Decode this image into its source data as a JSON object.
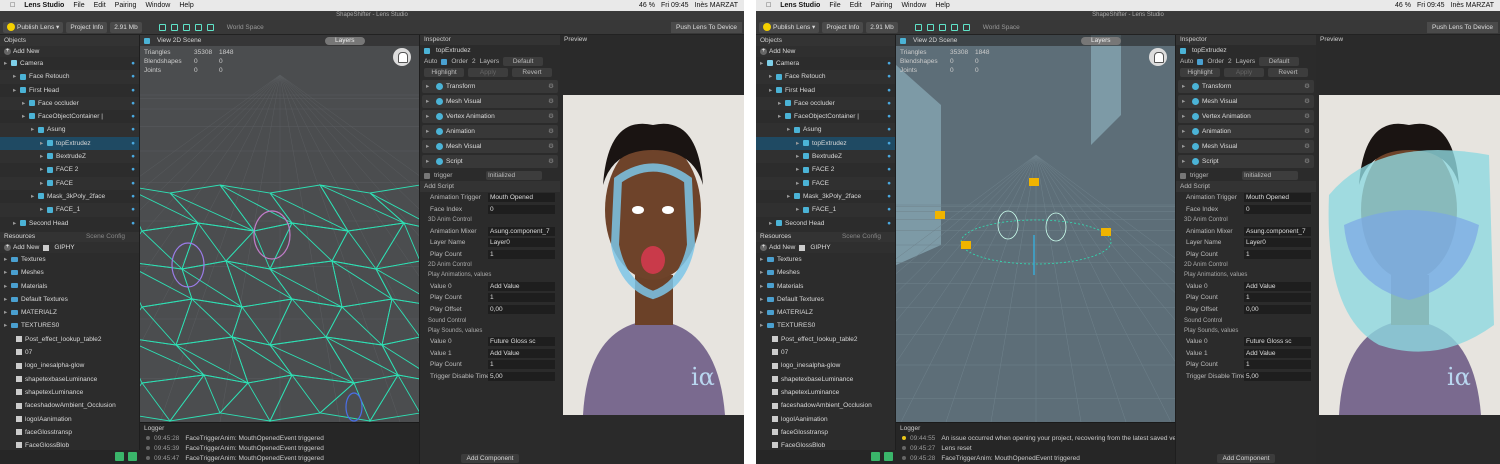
{
  "menubar": {
    "app": "Lens Studio",
    "items": [
      "File",
      "Edit",
      "Pairing",
      "Window",
      "Help"
    ],
    "battery": "46 %",
    "clock": "Fri 09:45",
    "user": "Inès MARZAT"
  },
  "window_title": "ShapeShifter - Lens Studio",
  "toolbar": {
    "publish": "Publish Lens",
    "project_info": "Project Info",
    "size": "2.91 Mb",
    "world_space": "World Space",
    "push": "Push Lens To Device"
  },
  "objects": {
    "title": "Objects",
    "add_new": "Add New",
    "rows": [
      {
        "label": "Camera",
        "indent": 0,
        "icon": "camera"
      },
      {
        "label": "Face Retouch",
        "indent": 1
      },
      {
        "label": "First Head",
        "indent": 1
      },
      {
        "label": "Face occluder",
        "indent": 2
      },
      {
        "label": "FaceObjectContainer |",
        "indent": 2
      },
      {
        "label": "Asung",
        "indent": 3
      },
      {
        "label": "topExtrudez",
        "indent": 4,
        "selected": true
      },
      {
        "label": "BextrudeZ",
        "indent": 4
      },
      {
        "label": "FACE 2",
        "indent": 4
      },
      {
        "label": "FACE",
        "indent": 4
      },
      {
        "label": "Mask_3kPoly_2face",
        "indent": 3
      },
      {
        "label": "FACE_1",
        "indent": 4
      },
      {
        "label": "Second Head",
        "indent": 1
      }
    ]
  },
  "resources": {
    "tab_resources": "Resources",
    "tab_scene": "Scene Config",
    "add_new": "Add New",
    "giphy": "GIPHY",
    "items": [
      {
        "label": "Textures",
        "type": "folder",
        "indent": 0
      },
      {
        "label": "Meshes",
        "type": "folder",
        "indent": 0
      },
      {
        "label": "Materials",
        "type": "folder",
        "indent": 0
      },
      {
        "label": "Default Textures",
        "type": "folder",
        "indent": 0
      },
      {
        "label": "MATERIALZ",
        "type": "folder",
        "indent": 0
      },
      {
        "label": "TEXTURES0",
        "type": "folder",
        "indent": 0
      },
      {
        "label": "Post_effect_lookup_table2",
        "type": "file",
        "indent": 1
      },
      {
        "label": "07",
        "type": "file",
        "indent": 1
      },
      {
        "label": "logo_inesalpha-glow",
        "type": "file",
        "indent": 1
      },
      {
        "label": "shapetexbaseLuminance",
        "type": "file",
        "indent": 1
      },
      {
        "label": "shapetexLuminance",
        "type": "file",
        "indent": 1
      },
      {
        "label": "faceshadowAmbient_Occlusion",
        "type": "file",
        "indent": 1
      },
      {
        "label": "logoIAanimation",
        "type": "file",
        "indent": 1
      },
      {
        "label": "faceGlosstransp",
        "type": "file",
        "indent": 1
      },
      {
        "label": "FaceGlossBlob",
        "type": "file",
        "indent": 1
      }
    ]
  },
  "viewport": {
    "view2d": "View 2D Scene",
    "layers": "Layers",
    "stats": [
      {
        "label": "Triangles",
        "a": "35308",
        "b": "1848"
      },
      {
        "label": "Blendshapes",
        "a": "0",
        "b": "0"
      },
      {
        "label": "Joints",
        "a": "0",
        "b": "0"
      }
    ]
  },
  "logger_a": {
    "title": "Logger",
    "lines": [
      {
        "time": "09:45:28",
        "msg": "FaceTriggerAnim: MouthOpenedEvent triggered",
        "warn": false
      },
      {
        "time": "09:45:39",
        "msg": "FaceTriggerAnim: MouthOpenedEvent triggered",
        "warn": false
      },
      {
        "time": "09:45:47",
        "msg": "FaceTriggerAnim: MouthOpenedEvent triggered",
        "warn": false
      }
    ]
  },
  "logger_b": {
    "title": "Logger",
    "lines": [
      {
        "time": "09:44:55",
        "msg": "An issue occurred when opening your project, recovering from the latest saved version",
        "warn": true
      },
      {
        "time": "09:45:27",
        "msg": "Lens reset",
        "warn": false
      },
      {
        "time": "09:45:28",
        "msg": "FaceTriggerAnim: MouthOpenedEvent triggered",
        "warn": false
      }
    ]
  },
  "inspector": {
    "title": "Inspector",
    "object": "topExtrudez",
    "auto": "Auto",
    "order": "Order",
    "order_val": "2",
    "layers": "Layers",
    "default": "Default",
    "highlight": "Highlight",
    "apply": "Apply",
    "revert": "Revert",
    "components": [
      "Transform",
      "Mesh Visual",
      "Vertex Animation",
      "Animation",
      "Mesh Visual",
      "Script"
    ],
    "script_name": "trigger",
    "script_state": "Initialized",
    "add_script": "Add Script",
    "props": [
      {
        "type": "prop",
        "label": "Animation Trigger",
        "value": "Mouth Opened"
      },
      {
        "type": "prop",
        "label": "Face Index",
        "value": "0"
      },
      {
        "type": "sect",
        "label": "3D Anim Control"
      },
      {
        "type": "prop",
        "label": "Animation Mixer",
        "value": "Asung.component_7"
      },
      {
        "type": "prop",
        "label": "Layer Name",
        "value": "Layer0"
      },
      {
        "type": "prop",
        "label": "Play Count",
        "value": "1"
      },
      {
        "type": "sect",
        "label": "2D Anim Control"
      },
      {
        "type": "sect",
        "label": "Play Animations, values"
      },
      {
        "type": "prop",
        "label": "Value 0",
        "value": "Add Value"
      },
      {
        "type": "prop",
        "label": "Play Count",
        "value": "1"
      },
      {
        "type": "prop",
        "label": "Play Offset",
        "value": "0,00"
      },
      {
        "type": "sect",
        "label": "Sound Control"
      },
      {
        "type": "sect",
        "label": "Play Sounds, values"
      },
      {
        "type": "prop",
        "label": "Value 0",
        "value": "Future Gloss sc"
      },
      {
        "type": "prop",
        "label": "Value 1",
        "value": "Add Value"
      },
      {
        "type": "prop",
        "label": "Play Count",
        "value": "1"
      },
      {
        "type": "prop",
        "label": "Trigger Disable Time",
        "value": "5,00"
      }
    ],
    "add_component": "Add Component"
  },
  "preview": {
    "title": "Preview",
    "logo": "iα"
  }
}
